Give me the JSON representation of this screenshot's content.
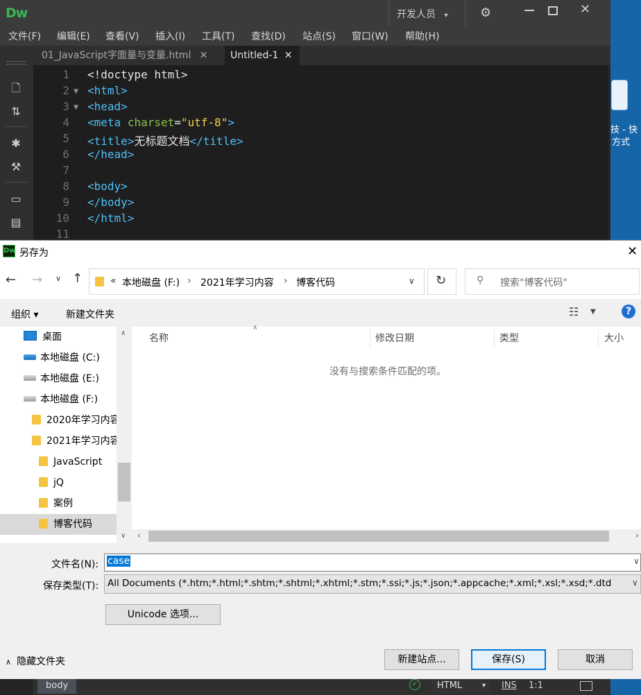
{
  "dw": {
    "logo": "Dw",
    "workspace": "开发人员",
    "menu": [
      "文件(F)",
      "编辑(E)",
      "查看(V)",
      "插入(I)",
      "工具(T)",
      "查找(D)",
      "站点(S)",
      "窗口(W)",
      "帮助(H)"
    ],
    "tabs": [
      {
        "label": "01_JavaScript字面量与变量.html"
      },
      {
        "label": "Untitled-1"
      }
    ],
    "code_lines": [
      {
        "num": "1",
        "fold": "",
        "text": "<!doctype html>"
      },
      {
        "num": "2",
        "fold": "▼",
        "text": "<html>"
      },
      {
        "num": "3",
        "fold": "▼",
        "text": "<head>"
      },
      {
        "num": "4",
        "fold": "",
        "text": "<meta charset=\"utf-8\">"
      },
      {
        "num": "5",
        "fold": "",
        "text": "<title>无标题文档</title>"
      },
      {
        "num": "6",
        "fold": "",
        "text": "</head>"
      },
      {
        "num": "7",
        "fold": "",
        "text": ""
      },
      {
        "num": "8",
        "fold": "",
        "text": "<body>"
      },
      {
        "num": "9",
        "fold": "",
        "text": "</body>"
      },
      {
        "num": "10",
        "fold": "",
        "text": "</html>"
      },
      {
        "num": "11",
        "fold": "",
        "text": ""
      }
    ],
    "status": {
      "tag": "body",
      "lang": "HTML",
      "mode": "INS",
      "pos": "1:1"
    }
  },
  "desktop_icon": {
    "line1": "技 - 快",
    "line2": "方式"
  },
  "dialog": {
    "title": "另存为",
    "breadcrumb": [
      "本地磁盘 (F:)",
      "2021年学习内容",
      "博客代码"
    ],
    "breadcrumb_prefix": "«",
    "search_placeholder": "搜索\"博客代码\"",
    "organize_label": "组织 ▾",
    "new_folder_label": "新建文件夹",
    "nav_items": [
      {
        "label": "桌面",
        "kind": "desktop",
        "indent": 34
      },
      {
        "label": "本地磁盘 (C:)",
        "kind": "windrive",
        "indent": 34
      },
      {
        "label": "本地磁盘 (E:)",
        "kind": "drive",
        "indent": 34
      },
      {
        "label": "本地磁盘 (F:)",
        "kind": "drive",
        "indent": 34
      },
      {
        "label": "2020年学习内容",
        "kind": "folder",
        "indent": 46
      },
      {
        "label": "2021年学习内容",
        "kind": "folder",
        "indent": 46
      },
      {
        "label": "JavaScript",
        "kind": "folder",
        "indent": 56
      },
      {
        "label": "jQ",
        "kind": "folder",
        "indent": 56
      },
      {
        "label": "案例",
        "kind": "folder",
        "indent": 56
      },
      {
        "label": "博客代码",
        "kind": "folder",
        "indent": 56,
        "selected": true
      }
    ],
    "columns": [
      "名称",
      "修改日期",
      "类型",
      "大小"
    ],
    "empty_message": "没有与搜索条件匹配的项。",
    "filename_label": "文件名(N):",
    "filename_value": "case",
    "filetype_label": "保存类型(T):",
    "filetype_value": "All Documents (*.htm;*.html;*.shtm;*.shtml;*.xhtml;*.stm;*.ssi;*.js;*.json;*.appcache;*.xml;*.xsl;*.xsd;*.dtd",
    "unicode_button": "Unicode 选项...",
    "hide_folders": "隐藏文件夹",
    "new_site_button": "新建站点...",
    "save_button": "保存(S)",
    "cancel_button": "取消"
  }
}
